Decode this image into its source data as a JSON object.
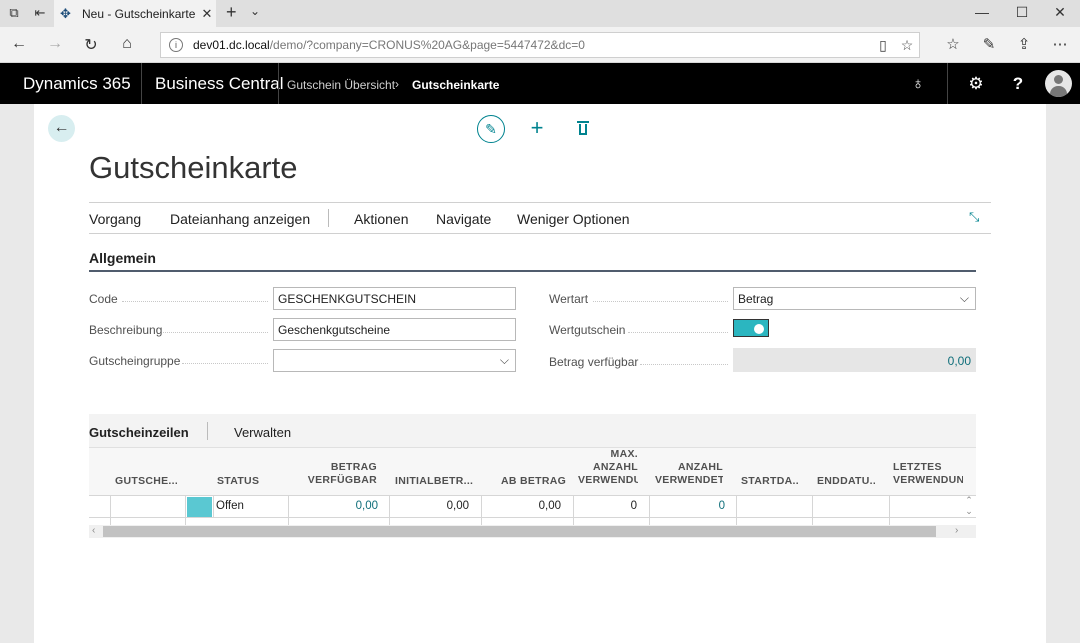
{
  "browser": {
    "tab_title": "Neu - Gutscheinkarte -",
    "url_host": "dev01.dc.local",
    "url_path": "/demo/?company=CRONUS%20AG&page=5447472&dc=0"
  },
  "app": {
    "brand": "Dynamics 365",
    "product": "Business Central",
    "breadcrumb_parent": "Gutschein Übersicht",
    "breadcrumb_current": "Gutscheinkarte"
  },
  "page": {
    "title": "Gutscheinkarte",
    "actions": [
      "Vorgang",
      "Dateianhang anzeigen",
      "Aktionen",
      "Navigate",
      "Weniger Optionen"
    ]
  },
  "general": {
    "section_title": "Allgemein",
    "code_label": "Code",
    "code_value": "GESCHENKGUTSCHEIN",
    "desc_label": "Beschreibung",
    "desc_value": "Geschenkgutscheine",
    "group_label": "Gutscheingruppe",
    "group_value": "",
    "valuetype_label": "Wertart",
    "valuetype_value": "Betrag",
    "valuevoucher_label": "Wertgutschein",
    "valuevoucher_on": true,
    "available_label": "Betrag verfügbar",
    "available_value": "0,00"
  },
  "lines": {
    "title": "Gutscheinzeilen",
    "action": "Verwalten",
    "headers": {
      "code": "GUTSCHE...",
      "status": "STATUS",
      "betrag1": "BETRAG",
      "betrag2": "VERFÜGBAR",
      "initial": "INITIALBETR...",
      "ab": "AB BETRAG",
      "max1": "MAX.",
      "max2": "ANZAHL",
      "max3": "VERWENDU",
      "anz1": "ANZAHL",
      "anz2": "VERWENDET",
      "start": "STARTDA...",
      "end": "ENDDATU...",
      "last1": "LETZTES",
      "last2": "VERWENDUN"
    },
    "rows": [
      {
        "code": "",
        "status": "Offen",
        "betrag_verfuegbar": "0,00",
        "initialbetrag": "0,00",
        "ab_betrag": "0,00",
        "max_anzahl": "0",
        "anzahl_verwendet": "0",
        "startdatum": "",
        "enddatum": "",
        "letztes": ""
      }
    ]
  },
  "colors": {
    "accent": "#00838f",
    "status_swatch": "#5ac8d2",
    "toggle_on": "#2bb6c0"
  }
}
